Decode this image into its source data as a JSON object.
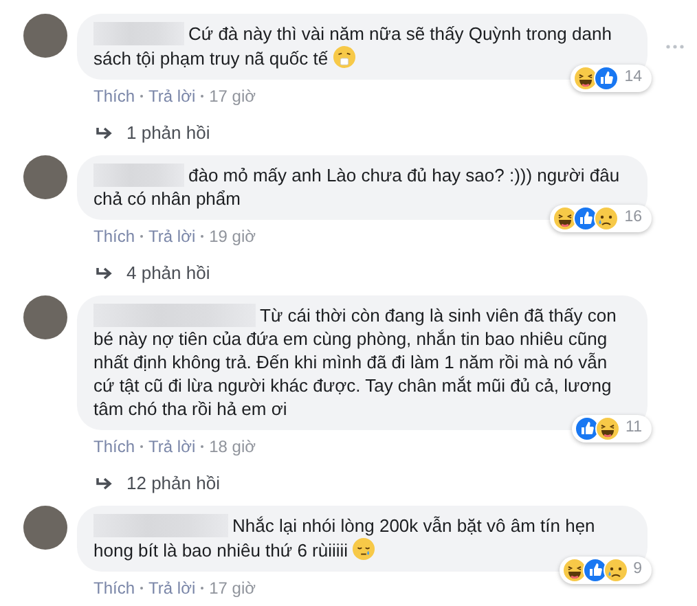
{
  "comments": [
    {
      "text": "Cứ đà này thì vài năm nữa sẽ thấy Quỳnh trong danh sách tội phạm truy nã quốc tế",
      "emoji": {
        "kind": "sneeze"
      },
      "reactions": [
        {
          "kind": "haha"
        },
        {
          "kind": "like"
        }
      ],
      "reaction_count": "14",
      "actions": [
        "Thích",
        "Trả lời"
      ],
      "time": "17 giờ",
      "replies": "1 phản hồi",
      "menu": true
    },
    {
      "text": "đào mỏ mấy anh Lào chưa đủ hay sao? :))) người đâu chả có nhân phẩm",
      "reactions": [
        {
          "kind": "haha"
        },
        {
          "kind": "like"
        },
        {
          "kind": "sad"
        }
      ],
      "reaction_count": "16",
      "actions": [
        "Thích",
        "Trả lời"
      ],
      "time": "19 giờ",
      "replies": "4 phản hồi",
      "menu": false
    },
    {
      "text": "Từ cái thời còn đang là sinh viên đã thấy con bé này nợ tiên của đứa em cùng phòng, nhắn tin bao nhiêu cũng nhất định không trả. Đến khi mình đã đi làm 1 năm rồi mà nó vẫn cứ tật cũ đi lừa người khác được. Tay chân mắt mũi đủ cả, lương tâm chó tha rồi hả em ơi",
      "reactions": [
        {
          "kind": "like"
        },
        {
          "kind": "haha"
        }
      ],
      "reaction_count": "11",
      "actions": [
        "Thích",
        "Trả lời"
      ],
      "time": "18 giờ",
      "replies": "12 phản hồi",
      "menu": false
    },
    {
      "text": "Nhắc lại nhói lòng 200k vẫn bặt vô âm tín hẹn hong bít là bao nhiêu thứ 6 rùiiiii",
      "emoji": {
        "kind": "sleepy"
      },
      "reactions": [
        {
          "kind": "haha"
        },
        {
          "kind": "like"
        },
        {
          "kind": "sad"
        }
      ],
      "reaction_count": "9",
      "actions": [
        "Thích",
        "Trả lời"
      ],
      "time": "17 giờ",
      "menu": false
    }
  ]
}
